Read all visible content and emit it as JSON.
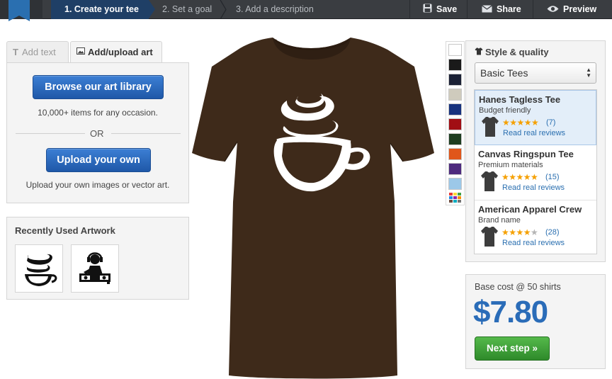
{
  "topbar": {
    "steps": [
      {
        "label": "1. Create your tee"
      },
      {
        "label": "2. Set a goal"
      },
      {
        "label": "3. Add a description"
      }
    ],
    "actions": {
      "save": "Save",
      "share": "Share",
      "preview": "Preview"
    }
  },
  "tabs": {
    "add_text": "Add text",
    "add_upload_art": "Add/upload art"
  },
  "art_panel": {
    "browse_button": "Browse our art library",
    "browse_sub": "10,000+ items for any occasion.",
    "or": "OR",
    "upload_button": "Upload your own",
    "upload_sub": "Upload your own images or vector art."
  },
  "recent": {
    "title": "Recently Used Artwork",
    "items": [
      {
        "icon": "coffee-cup-icon"
      },
      {
        "icon": "dj-icon"
      }
    ]
  },
  "colors": {
    "shirt": "#3e2a1a",
    "swatches": [
      "#ffffff",
      "#1a1a1a",
      "#1b2135",
      "#cfcbbd",
      "#17327e",
      "#a10e14",
      "#1d3d20",
      "#e0561a",
      "#4d2a7e",
      "#9cc8e8"
    ]
  },
  "style_panel": {
    "title": "Style & quality",
    "select_value": "Basic Tees",
    "products": [
      {
        "name": "Hanes Tagless Tee",
        "desc": "Budget friendly",
        "stars": "★★★★★",
        "count": "(7)",
        "reviews": "Read real reviews"
      },
      {
        "name": "Canvas Ringspun Tee",
        "desc": "Premium materials",
        "stars": "★★★★★",
        "count": "(15)",
        "reviews": "Read real reviews"
      },
      {
        "name": "American Apparel Crew",
        "desc": "Brand name",
        "stars_on": "★★★★",
        "stars_off": "★",
        "count": "(28)",
        "reviews": "Read real reviews"
      }
    ]
  },
  "cost": {
    "label": "Base cost @ 50 shirts",
    "value": "$7.80",
    "next": "Next step »"
  }
}
